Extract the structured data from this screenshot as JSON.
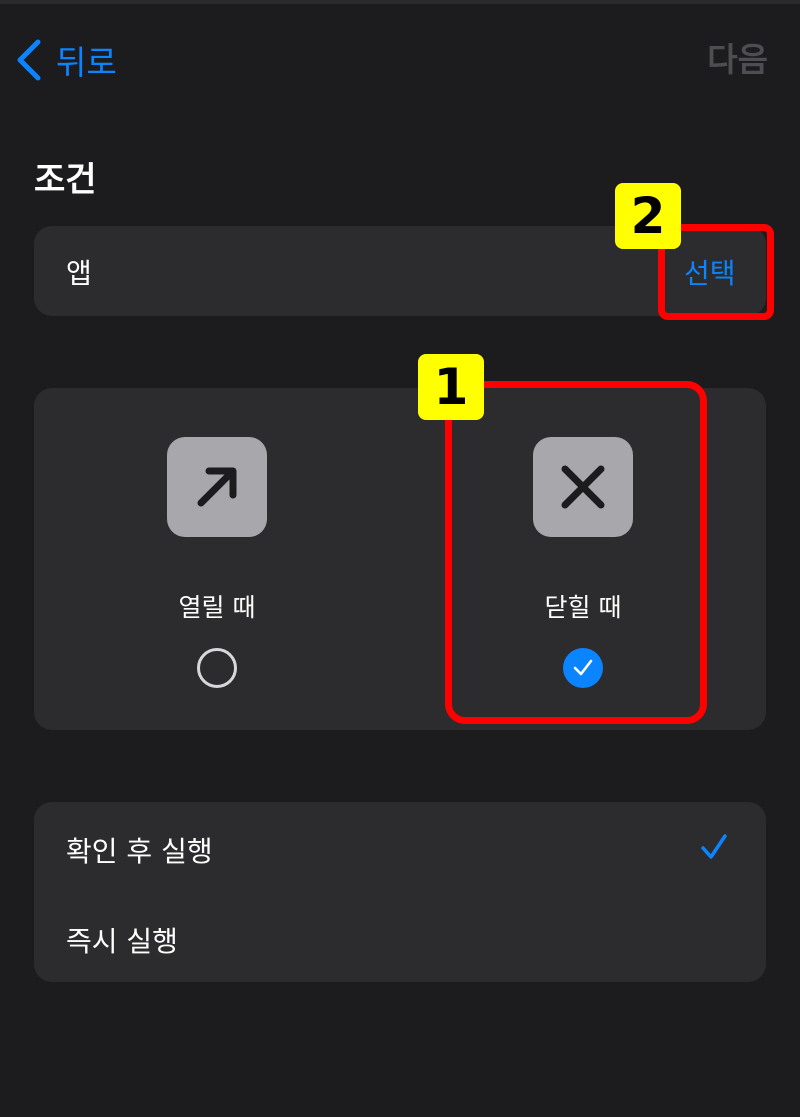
{
  "nav": {
    "back_label": "뒤로",
    "next_label": "다음"
  },
  "section_title": "조건",
  "app_row": {
    "label": "앱",
    "select_label": "선택"
  },
  "options": [
    {
      "label": "열릴 때",
      "icon": "arrow-up-right-icon",
      "selected": false
    },
    {
      "label": "닫힐 때",
      "icon": "x-mark-icon",
      "selected": true
    }
  ],
  "run_modes": [
    {
      "label": "확인 후 실행",
      "checked": true
    },
    {
      "label": "즉시 실행",
      "checked": false
    }
  ],
  "annotations": {
    "badge1": "1",
    "badge2": "2"
  },
  "colors": {
    "accent": "#0a84ff",
    "highlight": "#ff0000",
    "badge": "#ffff00",
    "background": "#1c1c1e",
    "card": "#2c2c2e"
  }
}
